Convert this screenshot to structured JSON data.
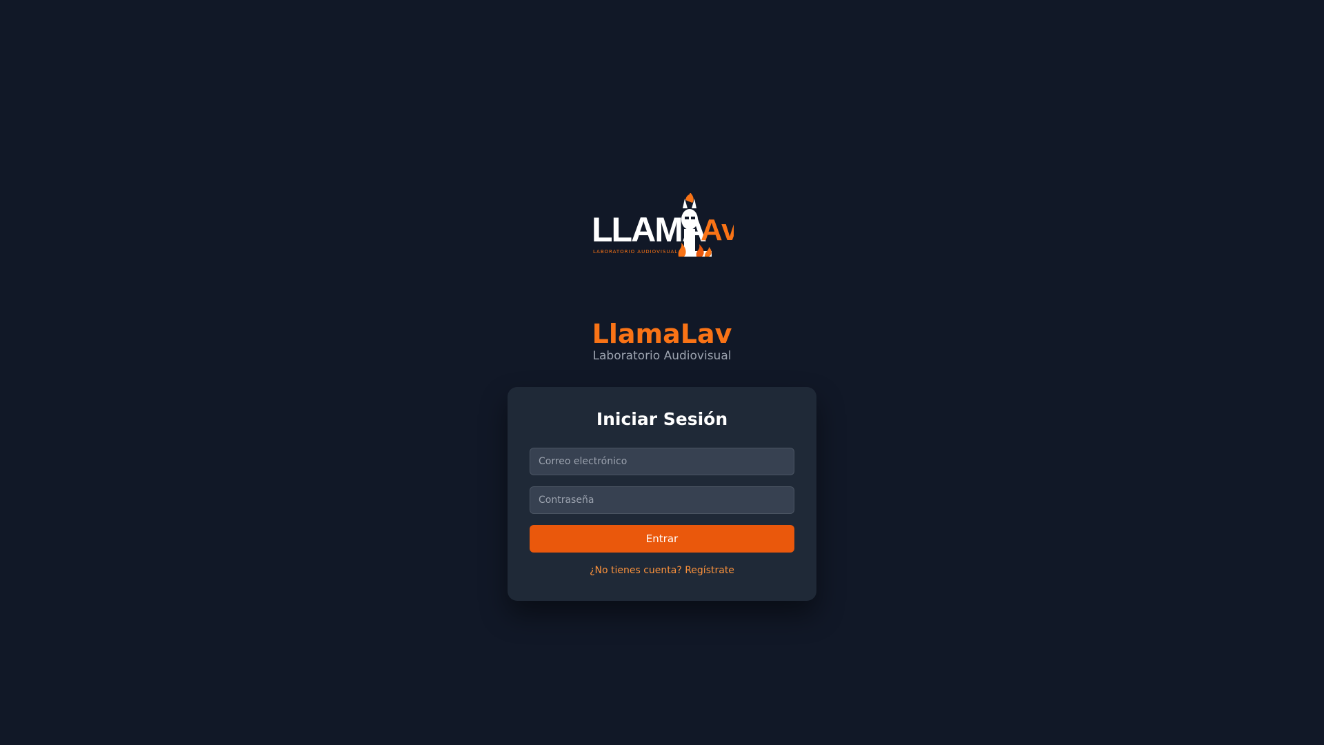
{
  "brand": {
    "title": "LlamaLav",
    "subtitle": "Laboratorio Audiovisual",
    "logo_wordmark": "LLAMALAV",
    "logo_tagline": "LABORATORIO AUDIOVISUAL"
  },
  "login": {
    "title": "Iniciar Sesión",
    "email_placeholder": "Correo electrónico",
    "password_placeholder": "Contraseña",
    "submit_label": "Entrar",
    "register_link": "¿No tienes cuenta? Regístrate"
  },
  "colors": {
    "background": "#111827",
    "card": "#1f2937",
    "accent": "#ea580c",
    "brand_text": "#f97316",
    "link": "#fb923c"
  },
  "icons": [
    "llama-logo-icon",
    "flame-icon"
  ]
}
